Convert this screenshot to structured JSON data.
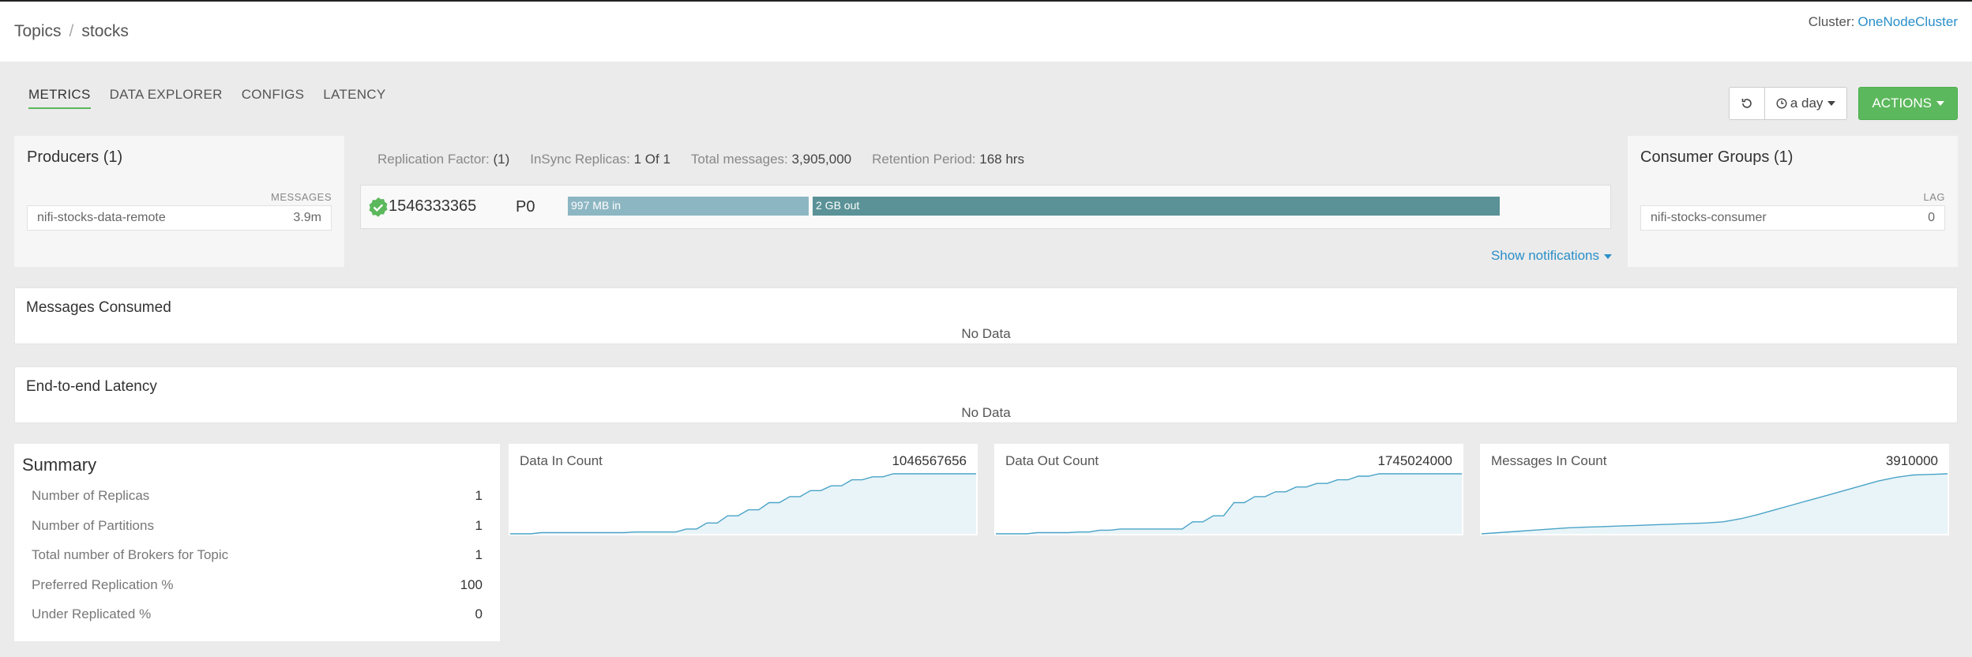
{
  "breadcrumb": {
    "root": "Topics",
    "separator": "/",
    "current": "stocks"
  },
  "cluster": {
    "label": "Cluster:",
    "name": "OneNodeCluster"
  },
  "tabs": [
    {
      "label": "METRICS",
      "active": true
    },
    {
      "label": "DATA EXPLORER"
    },
    {
      "label": "CONFIGS"
    },
    {
      "label": "LATENCY"
    }
  ],
  "toolbar": {
    "time_range": "a day",
    "actions_label": "ACTIONS"
  },
  "producers": {
    "title": "Producers (1)",
    "column": "MESSAGES",
    "items": [
      {
        "name": "nifi-stocks-data-remote",
        "value": "3.9m"
      }
    ]
  },
  "topic_stats": {
    "replication_label": "Replication Factor:",
    "replication_value": "(1)",
    "insync_label": "InSync Replicas:",
    "insync_value": "1 Of 1",
    "messages_label": "Total messages:",
    "messages_value": "3,905,000",
    "retention_label": "Retention Period:",
    "retention_value": "168 hrs"
  },
  "partition": {
    "id": "1546333365",
    "name": "P0",
    "in_label": "997 MB in",
    "out_label": "2 GB out"
  },
  "show_notifications": "Show notifications",
  "consumers": {
    "title": "Consumer Groups (1)",
    "column": "LAG",
    "items": [
      {
        "name": "nifi-stocks-consumer",
        "value": "0"
      }
    ]
  },
  "messages_consumed": {
    "title": "Messages Consumed",
    "empty": "No Data"
  },
  "latency": {
    "title": "End-to-end Latency",
    "empty": "No Data"
  },
  "summary": {
    "title": "Summary",
    "rows": [
      {
        "label": "Number of Replicas",
        "value": "1"
      },
      {
        "label": "Number of Partitions",
        "value": "1"
      },
      {
        "label": "Total number of Brokers for Topic",
        "value": "1"
      },
      {
        "label": "Preferred Replication %",
        "value": "100"
      },
      {
        "label": "Under Replicated %",
        "value": "0"
      }
    ]
  },
  "colors": {
    "accent_green": "#5cb85c",
    "link": "#2a8fc9",
    "bar_in": "#8db6c3",
    "bar_out": "#5a9297",
    "spark_line": "#4aa3c7",
    "spark_fill": "#e8f4f8"
  },
  "chart_data": [
    {
      "type": "area",
      "title": "Data In Count",
      "latest": "1046567656",
      "values": [
        0,
        0,
        0,
        2,
        2,
        2,
        2,
        2,
        2,
        2,
        2,
        2,
        3,
        3,
        3,
        3,
        3,
        8,
        8,
        18,
        18,
        30,
        30,
        40,
        40,
        52,
        52,
        62,
        62,
        72,
        72,
        80,
        80,
        90,
        90,
        95,
        95,
        100,
        100,
        100,
        100,
        100,
        100,
        100,
        100,
        100
      ]
    },
    {
      "type": "area",
      "title": "Data Out Count",
      "latest": "1745024000",
      "values": [
        0,
        0,
        0,
        0,
        2,
        2,
        2,
        2,
        3,
        3,
        6,
        6,
        8,
        8,
        8,
        8,
        8,
        8,
        8,
        20,
        20,
        30,
        30,
        52,
        52,
        62,
        62,
        70,
        70,
        78,
        78,
        84,
        84,
        90,
        90,
        96,
        96,
        100,
        100,
        100,
        100,
        100,
        100,
        100,
        100,
        100
      ]
    },
    {
      "type": "area",
      "title": "Messages In Count",
      "latest": "3910000",
      "values": [
        0,
        2,
        4,
        6,
        8,
        10,
        11,
        12,
        13,
        14,
        15,
        16,
        17,
        18,
        20,
        25,
        32,
        40,
        48,
        56,
        64,
        72,
        80,
        88,
        94,
        98,
        99,
        100
      ]
    }
  ]
}
